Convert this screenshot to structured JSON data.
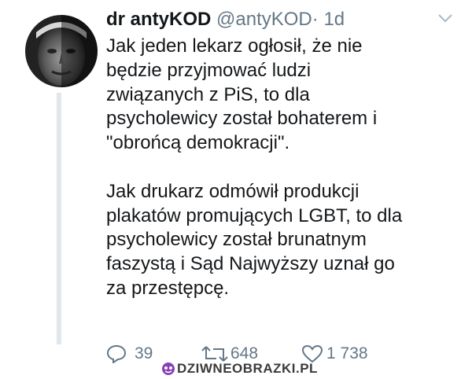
{
  "tweet": {
    "display_name": "dr antyKOD",
    "handle": "@antyKOD",
    "separator": "·",
    "time": "1d",
    "paragraphs": [
      "Jak jeden lekarz ogłosił, że nie\nbędzie przyjmować ludzi\nzwiązanych z PiS, to dla\npsycholewicy został bohaterem i\n\"obrońcą demokracji\".",
      "Jak drukarz odmówił produkcji\nplakatów promujących LGBT, to dla\npsycholewicy został brunatnym\nfaszystą i Sąd Najwyższy uznał go\nza przestępcę."
    ],
    "replies": "39",
    "retweets": "648",
    "likes": "1 738"
  },
  "watermark": {
    "text": "DZIWNEOBRAZKI.PL"
  },
  "icons": {
    "avatar": "avatar-portrait",
    "menu": "chevron-down-icon",
    "reply": "reply-icon",
    "retweet": "retweet-icon",
    "like": "heart-icon",
    "watermark_logo": "watermark-logo-icon"
  },
  "colors": {
    "text": "#14171a",
    "muted": "#657786",
    "thread_line": "#e1e8ed",
    "watermark_logo": "#8a3fb5"
  }
}
